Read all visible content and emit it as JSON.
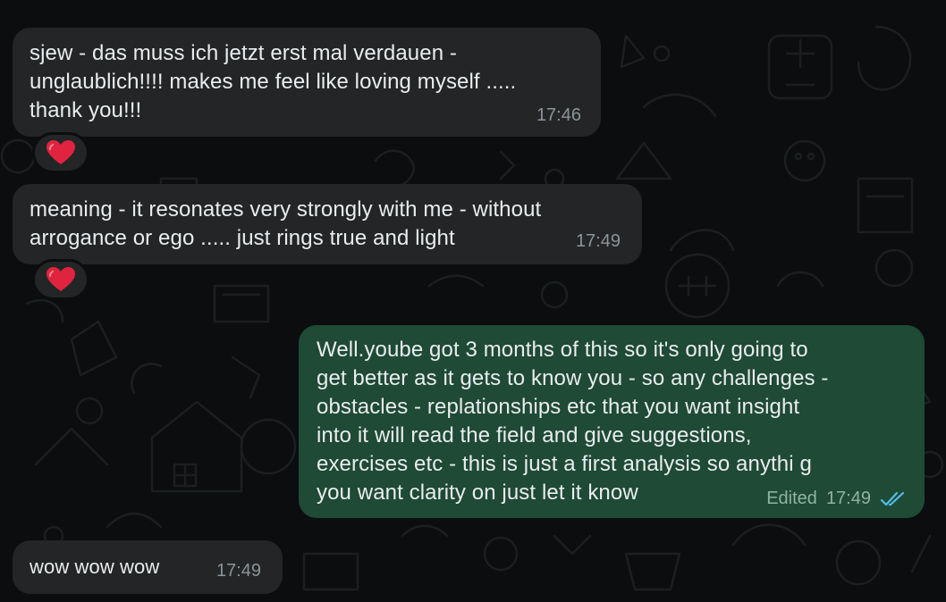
{
  "messages": [
    {
      "direction": "incoming",
      "text": "sjew - das muss ich jetzt erst mal verdauen -\nunglaublich!!!! makes me feel like loving myself .....\nthank you!!!",
      "time": "17:46",
      "reaction": "heart"
    },
    {
      "direction": "incoming",
      "text": "meaning - it resonates very strongly with me - without\narrogance or ego ..... just rings true and light",
      "time": "17:49",
      "reaction": "heart"
    },
    {
      "direction": "outgoing",
      "text": "Well.yoube got 3 months of this so it's only going to\nget better as it gets to know you - so any challenges -\nobstacles - replationships etc that you want insight\ninto it will read the field and give suggestions,\nexercises etc - this is just a first analysis so anythi g\nyou want clarity on just let it know",
      "edited_label": "Edited",
      "time": "17:49",
      "status_icon": "double-check-icon"
    },
    {
      "direction": "incoming",
      "text": "wow wow wow",
      "time": "17:49"
    }
  ],
  "colors": {
    "background": "#0b0d0e",
    "incoming_bubble": "#232526",
    "outgoing_bubble": "#1f4a35",
    "read_check": "#53bdeb",
    "heart": "#e0243f"
  }
}
